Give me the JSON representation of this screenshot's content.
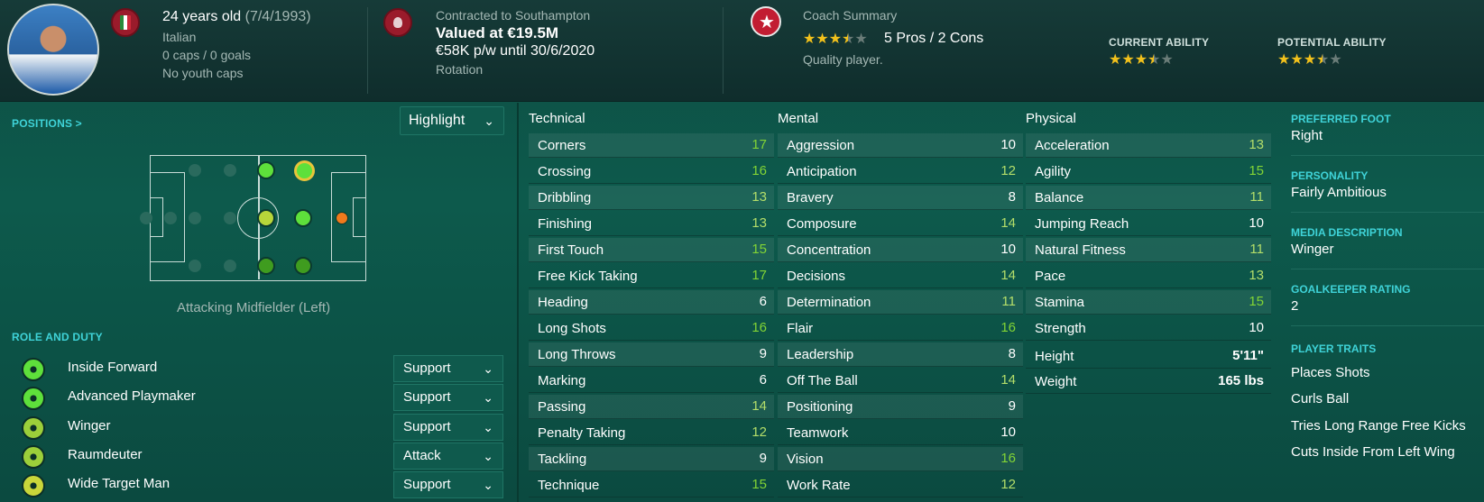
{
  "header": {
    "age_text": "24 years old",
    "dob_text": "(7/4/1993)",
    "nationality": "Italian",
    "caps_goals": "0 caps / 0 goals",
    "youth_caps": "No youth caps",
    "contract_club": "Contracted to Southampton",
    "value": "Valued at €19.5M",
    "wage": "€58K p/w until 30/6/2020",
    "squad_status": "Rotation",
    "coach_title": "Coach Summary",
    "coach_stars": 3.5,
    "pros_cons": "5 Pros / 2 Cons",
    "coach_comment": "Quality player.",
    "current_ability_label": "CURRENT ABILITY",
    "current_ability_stars": 3.5,
    "potential_ability_label": "POTENTIAL ABILITY",
    "potential_ability_stars": 3.5
  },
  "positions": {
    "title": "POSITIONS >",
    "highlight_label": "Highlight",
    "position_label": "Attacking Midfielder (Left)"
  },
  "roles": {
    "title": "ROLE AND DUTY",
    "items": [
      {
        "name": "Inside Forward",
        "duty": "Support"
      },
      {
        "name": "Advanced Playmaker",
        "duty": "Support"
      },
      {
        "name": "Winger",
        "duty": "Support"
      },
      {
        "name": "Raumdeuter",
        "duty": "Attack"
      },
      {
        "name": "Wide Target Man",
        "duty": "Support"
      }
    ]
  },
  "attributes": {
    "technical": {
      "title": "Technical",
      "rows": [
        {
          "name": "Corners",
          "value": "17"
        },
        {
          "name": "Crossing",
          "value": "16"
        },
        {
          "name": "Dribbling",
          "value": "13"
        },
        {
          "name": "Finishing",
          "value": "13"
        },
        {
          "name": "First Touch",
          "value": "15"
        },
        {
          "name": "Free Kick Taking",
          "value": "17"
        },
        {
          "name": "Heading",
          "value": "6"
        },
        {
          "name": "Long Shots",
          "value": "16"
        },
        {
          "name": "Long Throws",
          "value": "9"
        },
        {
          "name": "Marking",
          "value": "6"
        },
        {
          "name": "Passing",
          "value": "14"
        },
        {
          "name": "Penalty Taking",
          "value": "12"
        },
        {
          "name": "Tackling",
          "value": "9"
        },
        {
          "name": "Technique",
          "value": "15"
        }
      ]
    },
    "mental": {
      "title": "Mental",
      "rows": [
        {
          "name": "Aggression",
          "value": "10"
        },
        {
          "name": "Anticipation",
          "value": "12"
        },
        {
          "name": "Bravery",
          "value": "8"
        },
        {
          "name": "Composure",
          "value": "14"
        },
        {
          "name": "Concentration",
          "value": "10"
        },
        {
          "name": "Decisions",
          "value": "14"
        },
        {
          "name": "Determination",
          "value": "11"
        },
        {
          "name": "Flair",
          "value": "16"
        },
        {
          "name": "Leadership",
          "value": "8"
        },
        {
          "name": "Off The Ball",
          "value": "14"
        },
        {
          "name": "Positioning",
          "value": "9"
        },
        {
          "name": "Teamwork",
          "value": "10"
        },
        {
          "name": "Vision",
          "value": "16"
        },
        {
          "name": "Work Rate",
          "value": "12"
        }
      ]
    },
    "physical": {
      "title": "Physical",
      "rows": [
        {
          "name": "Acceleration",
          "value": "13"
        },
        {
          "name": "Agility",
          "value": "15"
        },
        {
          "name": "Balance",
          "value": "11"
        },
        {
          "name": "Jumping Reach",
          "value": "10"
        },
        {
          "name": "Natural Fitness",
          "value": "11"
        },
        {
          "name": "Pace",
          "value": "13"
        },
        {
          "name": "Stamina",
          "value": "15"
        },
        {
          "name": "Strength",
          "value": "10"
        }
      ],
      "height_label": "Height",
      "height_value": "5'11\"",
      "weight_label": "Weight",
      "weight_value": "165 lbs"
    }
  },
  "info": {
    "preferred_foot_label": "PREFERRED FOOT",
    "preferred_foot": "Right",
    "personality_label": "PERSONALITY",
    "personality": "Fairly Ambitious",
    "media_label": "MEDIA DESCRIPTION",
    "media": "Winger",
    "gk_label": "GOALKEEPER RATING",
    "gk": "2",
    "traits_label": "PLAYER TRAITS",
    "traits": [
      "Places Shots",
      "Curls Ball",
      "Tries Long Range Free Kicks",
      "Cuts Inside From Left Wing"
    ]
  },
  "colors": {
    "value_high": "#82d435",
    "value_mid": "#b4de6a",
    "value_low": "#ffffff",
    "accent": "#3fd3d8",
    "star": "#f2c11c"
  },
  "icons": {
    "flag_badge": "italy-flag-icon",
    "club_badge": "club-crest-icon",
    "coach_badge": "star-badge-icon"
  }
}
